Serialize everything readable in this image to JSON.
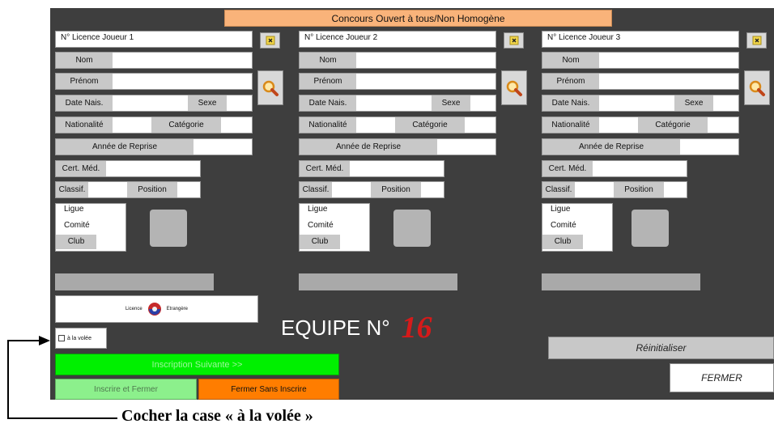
{
  "window": {
    "title": "Concours Ouvert à tous/Non Homogène"
  },
  "players": [
    {
      "licence_label": "N° Licence Joueur 1",
      "nom_label": "Nom",
      "prenom_label": "Prénom",
      "date_nais_label": "Date Nais.",
      "sexe_label": "Sexe",
      "nationalite_label": "Nationalité",
      "categorie_label": "Catégorie",
      "annee_reprise_label": "Année de Reprise",
      "cert_med_label": "Cert. Méd.",
      "classif_label": "Classif.",
      "position_label": "Position",
      "ligue_label": "Ligue",
      "comite_label": "Comité",
      "club_label": "Club"
    },
    {
      "licence_label": "N° Licence Joueur 2",
      "nom_label": "Nom",
      "prenom_label": "Prénom",
      "date_nais_label": "Date Nais.",
      "sexe_label": "Sexe",
      "nationalite_label": "Nationalité",
      "categorie_label": "Catégorie",
      "annee_reprise_label": "Année de Reprise",
      "cert_med_label": "Cert. Méd.",
      "classif_label": "Classif.",
      "position_label": "Position",
      "ligue_label": "Ligue",
      "comite_label": "Comité",
      "club_label": "Club"
    },
    {
      "licence_label": "N° Licence Joueur 3",
      "nom_label": "Nom",
      "prenom_label": "Prénom",
      "date_nais_label": "Date Nais.",
      "sexe_label": "Sexe",
      "nationalite_label": "Nationalité",
      "categorie_label": "Catégorie",
      "annee_reprise_label": "Année de Reprise",
      "cert_med_label": "Cert. Méd.",
      "classif_label": "Classif.",
      "position_label": "Position",
      "ligue_label": "Ligue",
      "comite_label": "Comité",
      "club_label": "Club"
    }
  ],
  "icons": {
    "clear": "close-icon",
    "search": "magnifier-icon",
    "flag": "flag-badge-icon"
  },
  "licence_box": {
    "left_text": "Licence",
    "right_text": "Etrangère"
  },
  "checkbox": {
    "label": "à la volée",
    "checked": false
  },
  "equipe": {
    "label": "EQUIPE N°",
    "number": "16"
  },
  "buttons": {
    "inscription_suivante": "Inscription Suivante >>",
    "inscrire_fermer": "Inscrire et Fermer",
    "fermer_sans": "Fermer Sans Inscrire",
    "reinitialiser": "Réinitialiser",
    "fermer": "FERMER"
  },
  "annotation": {
    "text": "Cocher la case « à la volée »"
  },
  "colors": {
    "panel": "#3e3e3e",
    "title_bar": "#f9b37a",
    "inscription_green": "#00f000",
    "inscrire_green": "#8cf08c",
    "fermer_orange": "#ff7d00",
    "equipe_number": "#d51a1a"
  }
}
